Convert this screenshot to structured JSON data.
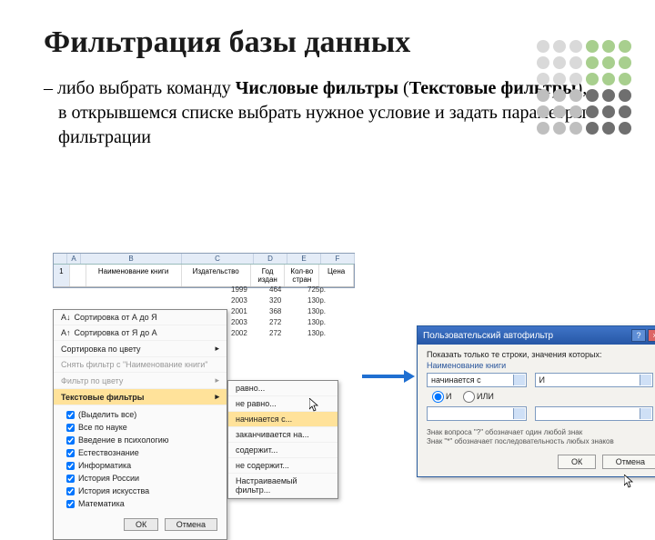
{
  "title": "Фильтрация базы данных",
  "body": {
    "dash": "– ",
    "text1": "либо выбрать команду ",
    "bold1": "Числовые фильтры",
    "text2": " (",
    "bold2": "Текстовые фильтры",
    "text3": "), в открывшемся списке выбрать нужное условие и задать параметры фильтрации"
  },
  "sheet": {
    "col_letters": [
      "",
      "A",
      "B",
      "C",
      "D",
      "E",
      "F"
    ],
    "headers": [
      "",
      "Наименование книги",
      "Издательство",
      "Год издан",
      "Кол-во стран",
      "Цена"
    ],
    "bg_values": [
      [
        "1999",
        "464",
        "725р."
      ],
      [
        "2003",
        "320",
        "130р."
      ],
      [
        "2001",
        "368",
        "130р."
      ],
      [
        "2003",
        "272",
        "130р."
      ],
      [
        "2002",
        "272",
        "130р."
      ]
    ]
  },
  "filter_menu": {
    "sort_az": "Сортировка от А до Я",
    "sort_za": "Сортировка от Я до А",
    "sort_color": "Сортировка по цвету",
    "clear": "Снять фильтр с \"Наименование книги\"",
    "by_color": "Фильтр по цвету",
    "text_filters": "Текстовые фильтры",
    "select_all": "(Выделить все)",
    "items": [
      "Все по науке",
      "Введение в психологию",
      "Естествознание",
      "Информатика",
      "История России",
      "История искусства",
      "Математика"
    ],
    "ok": "ОК",
    "cancel": "Отмена"
  },
  "submenu": {
    "equals": "равно...",
    "not_equals": "не равно...",
    "begins_with": "начинается с...",
    "ends_with": "заканчивается на...",
    "contains": "содержит...",
    "not_contains": "не содержит...",
    "custom": "Настраиваемый фильтр..."
  },
  "dialog": {
    "title": "Пользовательский автофильтр",
    "help_btn": "?",
    "close_btn": "×",
    "show_rows": "Показать только те строки, значения которых:",
    "field": "Наименование книги",
    "op1": "начинается с",
    "val1": "И",
    "radio_and": "И",
    "radio_or": "ИЛИ",
    "op2": "",
    "val2": "",
    "hint1": "Знак вопроса \"?\" обозначает один любой знак",
    "hint2": "Знак \"*\" обозначает последовательность любых знаков",
    "ok": "ОК",
    "cancel": "Отмена"
  },
  "dot_colors": [
    "#d9d9d9",
    "#d9d9d9",
    "#d9d9d9",
    "#a8cf8e",
    "#a8cf8e",
    "#a8cf8e",
    "#d9d9d9",
    "#d9d9d9",
    "#d9d9d9",
    "#a8cf8e",
    "#a8cf8e",
    "#a8cf8e",
    "#d9d9d9",
    "#d9d9d9",
    "#d9d9d9",
    "#a8cf8e",
    "#a8cf8e",
    "#a8cf8e",
    "#bfbfbf",
    "#bfbfbf",
    "#bfbfbf",
    "#6f6f6f",
    "#6f6f6f",
    "#6f6f6f",
    "#bfbfbf",
    "#bfbfbf",
    "#bfbfbf",
    "#6f6f6f",
    "#6f6f6f",
    "#6f6f6f",
    "#bfbfbf",
    "#bfbfbf",
    "#bfbfbf",
    "#6f6f6f",
    "#6f6f6f",
    "#6f6f6f"
  ]
}
